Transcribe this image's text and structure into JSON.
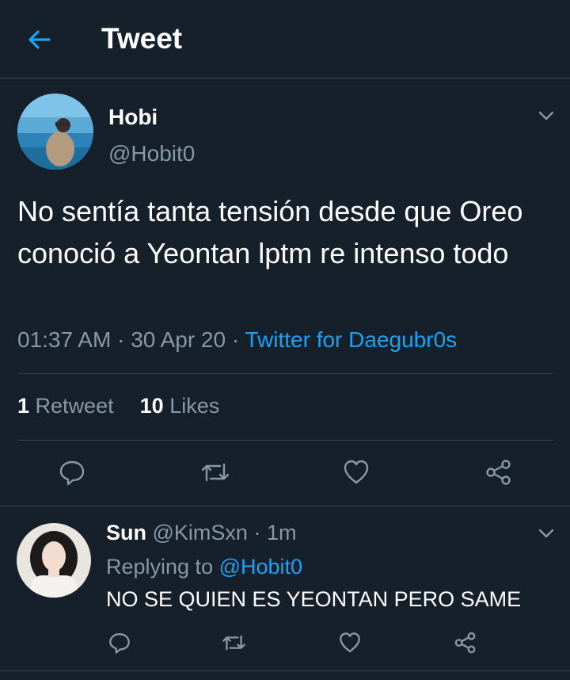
{
  "header": {
    "title": "Tweet"
  },
  "tweet": {
    "author_name": "Hobi",
    "author_handle": "@Hobit0",
    "text": "No sentía tanta tensión desde que Oreo conoció a Yeontan lptm re intenso todo",
    "time": "01:37 AM",
    "date": "30 Apr 20",
    "source": "Twitter for Daegubr0s",
    "retweet_count": "1",
    "retweet_label": "Retweet",
    "like_count": "10",
    "like_label": "Likes"
  },
  "reply": {
    "author_name": "Sun",
    "author_handle": "@KimSxn",
    "time": "1m",
    "replying_label": "Replying to",
    "replying_to": "@Hobit0",
    "text": "NO SE QUIEN ES YEONTAN PERO SAME"
  },
  "colors": {
    "background": "#15202b",
    "divider": "#38444d",
    "secondary_text": "#8899a6",
    "accent": "#1da1f2"
  },
  "icons": [
    "back-arrow-icon",
    "chevron-down-icon",
    "reply-icon",
    "retweet-icon",
    "like-icon",
    "share-icon"
  ]
}
